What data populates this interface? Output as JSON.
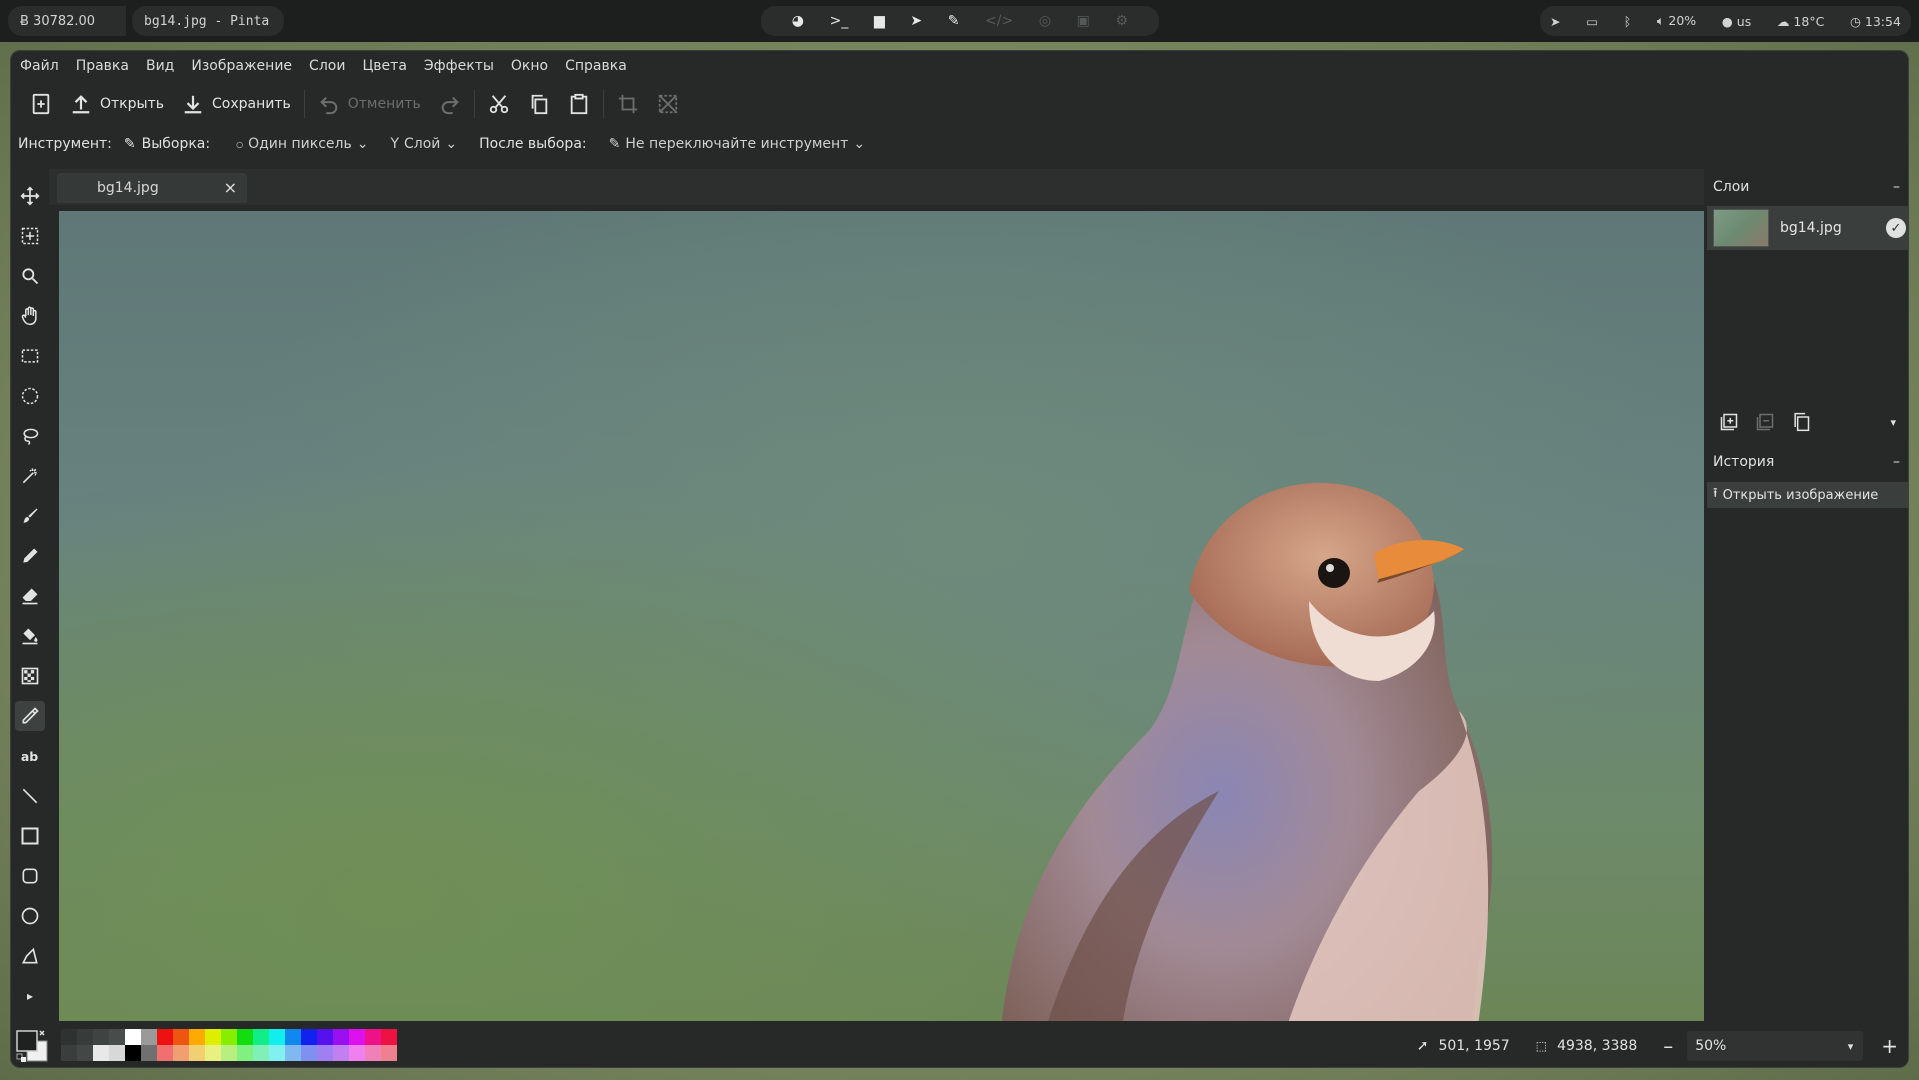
{
  "topbar": {
    "balance": "Ƀ 30782.00",
    "window_title": "bg14.jpg - Pinta",
    "center_icons": [
      "firefox-icon",
      "terminal-icon",
      "folder-icon",
      "telegram-icon",
      "brush-icon",
      "code-icon",
      "github-icon",
      "image-icon",
      "settings-icon"
    ],
    "tray": {
      "volume": "20%",
      "keyboard": "us",
      "weather": "18°C",
      "time": "13:54"
    }
  },
  "menu": [
    "Файл",
    "Правка",
    "Вид",
    "Изображение",
    "Слои",
    "Цвета",
    "Эффекты",
    "Окно",
    "Справка"
  ],
  "toolbar": {
    "open_label": "Открыть",
    "save_label": "Сохранить",
    "undo_label": "Отменить"
  },
  "options": {
    "tool_label": "Инструмент:",
    "sampling_label": "Выборка:",
    "sampling_value": "Один пиксель",
    "layer_value": "Слой",
    "after_select_label": "После выбора:",
    "after_select_value": "Не переключайте инструмент"
  },
  "tools": [
    "move-selection",
    "move-selected",
    "zoom",
    "pan",
    "rectangle-select",
    "ellipse-select",
    "lasso-select",
    "magic-wand",
    "paintbrush",
    "pencil",
    "eraser",
    "paint-bucket",
    "gradient",
    "color-picker",
    "text",
    "line",
    "rectangle",
    "rounded-rectangle",
    "ellipse",
    "freeform-shape"
  ],
  "active_tool": "color-picker",
  "document": {
    "tab_label": "bg14.jpg"
  },
  "layers": {
    "title": "Слои",
    "items": [
      {
        "name": "bg14.jpg",
        "visible": true
      }
    ]
  },
  "history": {
    "title": "История",
    "items": [
      "Открыть изображение"
    ]
  },
  "status": {
    "cursor_pos": "501, 1957",
    "image_size": "4938, 3388",
    "zoom": "50%"
  },
  "colors": {
    "primary": "#1f2120",
    "secondary": "#f0f0f0",
    "palette_top": [
      "#2e3231",
      "#373b3a",
      "#3f4342",
      "#484c4b",
      "#ffffff",
      "#9a9a9a",
      "#ee1111",
      "#ee5511",
      "#ffaa00",
      "#ddee00",
      "#88ee00",
      "#11dd11",
      "#11ee88",
      "#11eeee",
      "#1188ee",
      "#1122ee",
      "#5511ee",
      "#9911ee",
      "#dd11ee",
      "#ee1188",
      "#ee1144"
    ],
    "palette_bottom": [
      "#3a3e3d",
      "#434746",
      "#e8e8e8",
      "#d8d8d8",
      "#000000",
      "#707070",
      "#f07070",
      "#f0a070",
      "#f0d070",
      "#e8f080",
      "#b8f080",
      "#80f080",
      "#80f0b8",
      "#80f0f0",
      "#80b8f0",
      "#8090f0",
      "#a080f0",
      "#c080f0",
      "#f080f0",
      "#f080b8",
      "#f08090"
    ]
  }
}
